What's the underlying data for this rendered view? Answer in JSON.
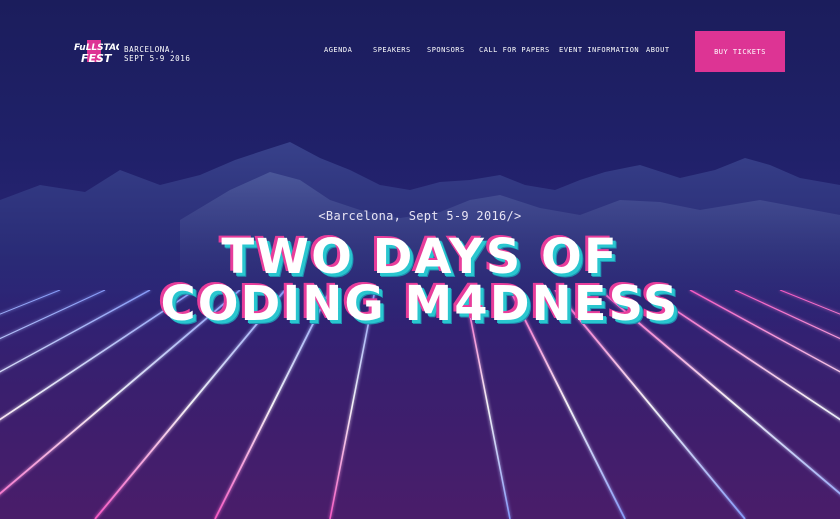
{
  "brand": {
    "logo_text": "FULLSTACK FEST",
    "location_line1": "BARCELONA,",
    "location_line2": "SEPT 5-9 2016"
  },
  "nav": {
    "items": [
      {
        "label": "AGENDA"
      },
      {
        "label": "SPEAKERS"
      },
      {
        "label": "SPONSORS"
      },
      {
        "label": "CALL FOR PAPERS"
      },
      {
        "label": "EVENT INFORMATION"
      },
      {
        "label": "ABOUT"
      }
    ],
    "cta_label": "BUY TICKETS"
  },
  "hero": {
    "subtitle": "<Barcelona, Sept 5-9 2016/>",
    "headline_line1": "TWO DAYS OF",
    "headline_line2": "CODING M4DNESS"
  },
  "colors": {
    "accent": "#dd3494",
    "background_top": "#1b1d5c",
    "headline_shadow_pink": "#e83d9b",
    "headline_shadow_cyan": "#29c6cf"
  },
  "icons": {
    "logo": "fullstack-fest-logo"
  }
}
